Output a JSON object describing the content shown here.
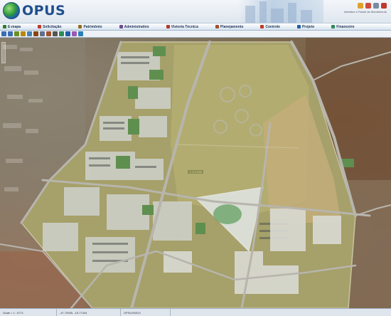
{
  "app": {
    "logo_text": "OPUS",
    "user_name": "Interface e Painel de Atendimento",
    "user_sub": ""
  },
  "menu": [
    {
      "label": "E-mapa",
      "icon": "map-icon",
      "color": "#2e7d32"
    },
    {
      "label": "Solicitação",
      "icon": "request-icon",
      "color": "#c0392b"
    },
    {
      "label": "Patrimônio",
      "icon": "building-icon",
      "color": "#8e6e1e"
    },
    {
      "label": "Administrativo",
      "icon": "admin-icon",
      "color": "#6d4c8f"
    },
    {
      "label": "Vistoria Técnica",
      "icon": "inspection-icon",
      "color": "#b03a2e"
    },
    {
      "label": "Planejamento",
      "icon": "planning-icon",
      "color": "#a0522d"
    },
    {
      "label": "Controle",
      "icon": "control-icon",
      "color": "#c0392b"
    },
    {
      "label": "Projeto",
      "icon": "project-icon",
      "color": "#1f5fa8"
    },
    {
      "label": "Financeiro",
      "icon": "finance-icon",
      "color": "#2e8b57"
    }
  ],
  "toolbar_icons": [
    "zoom-in-icon",
    "zoom-out-icon",
    "pan-icon",
    "home-icon",
    "identify-icon",
    "measure-icon",
    "select-icon",
    "clear-icon",
    "print-icon",
    "layers-icon",
    "info-icon",
    "draw-icon",
    "refresh-icon"
  ],
  "map": {
    "center_label": "1.172.636"
  },
  "status": {
    "scale": "Scale = 1 : 6771",
    "coords": "-47.70905, -15.77434",
    "ref": "OPSU/00913",
    "extra": ""
  },
  "colors": {
    "brand": "#1f4f8e",
    "menu_text": "#233a5c",
    "grass": "#9e9a62",
    "road": "#a9a9a3"
  }
}
